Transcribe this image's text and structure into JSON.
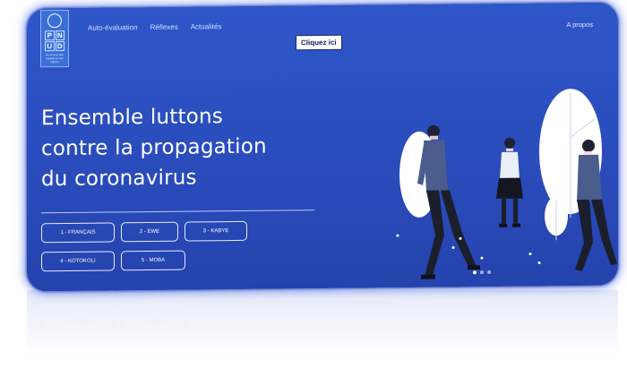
{
  "logo": {
    "cells": [
      "P",
      "N",
      "U",
      "D"
    ],
    "tagline": "Au service des peuples et des nations",
    "icon": "un-emblem-icon"
  },
  "nav": {
    "items": [
      "Auto-évaluation",
      "Réflexes",
      "Actualités"
    ],
    "cta": "Cliquez ici",
    "about": "A propos"
  },
  "hero": {
    "line1": "Ensemble luttons",
    "line2": "contre la propagation",
    "line3": "du coronavirus"
  },
  "languages": [
    "1 - FRANÇAIS",
    "2 - EWE",
    "3 - KABYE",
    "4 - KOTOKOLI",
    "5 - MOBA"
  ],
  "carousel": {
    "count": 3,
    "active": 1
  },
  "colors": {
    "background": "#2a4cbc",
    "button_border": "#e6ecff",
    "text": "#ffffff"
  }
}
